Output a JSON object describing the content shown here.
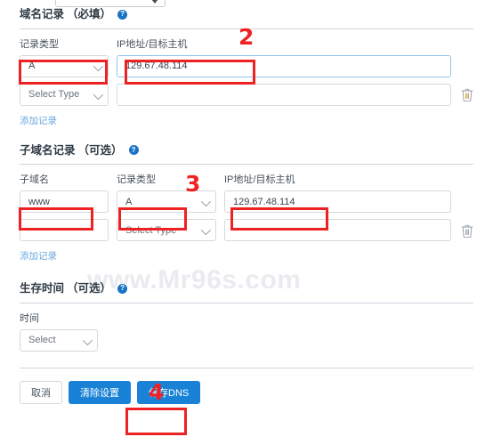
{
  "watermark": "www.Mr96s.com",
  "top_partial_select": {
    "name": "truncated-select",
    "caret": "caret-down-icon"
  },
  "sections": [
    {
      "id": "domain-records",
      "title": "域名记录",
      "optional_tag": "（必填）",
      "help_icon": "?",
      "columns": [
        "记录类型",
        "IP地址/目标主机"
      ],
      "rows": [
        {
          "type_value": "A",
          "host_value": "129.67.48.114",
          "host_focused": true,
          "has_trash": false
        },
        {
          "type_value": "Select Type",
          "type_is_placeholder": true,
          "host_value": "",
          "host_focused": false,
          "has_trash": true
        }
      ],
      "add_link": "添加记录"
    },
    {
      "id": "subdomain-records",
      "title": "子域名记录",
      "optional_tag": "（可选）",
      "help_icon": "?",
      "columns": [
        "子域名",
        "记录类型",
        "IP地址/目标主机"
      ],
      "rows": [
        {
          "sub_value": "www",
          "type_value": "A",
          "host_value": "129.67.48.114",
          "has_trash": false
        },
        {
          "sub_value": "",
          "type_value": "Select Type",
          "type_is_placeholder": true,
          "host_value": "",
          "has_trash": true
        }
      ],
      "add_link": "添加记录"
    },
    {
      "id": "ttl",
      "title": "生存时间",
      "optional_tag": "（可选）",
      "help_icon": "?",
      "columns": [
        "时间"
      ],
      "select_value": "Select"
    }
  ],
  "buttons": {
    "cancel": "取消",
    "clear": "清除设置",
    "save": "保存DNS"
  },
  "annotations": [
    {
      "number": "2"
    },
    {
      "number": "3"
    },
    {
      "number": "4"
    }
  ],
  "colors": {
    "annotation_red": "#ee2222",
    "primary_blue": "#1a82d6",
    "link_blue": "#6aa9e0",
    "focus_blue": "#8ec5f0"
  }
}
